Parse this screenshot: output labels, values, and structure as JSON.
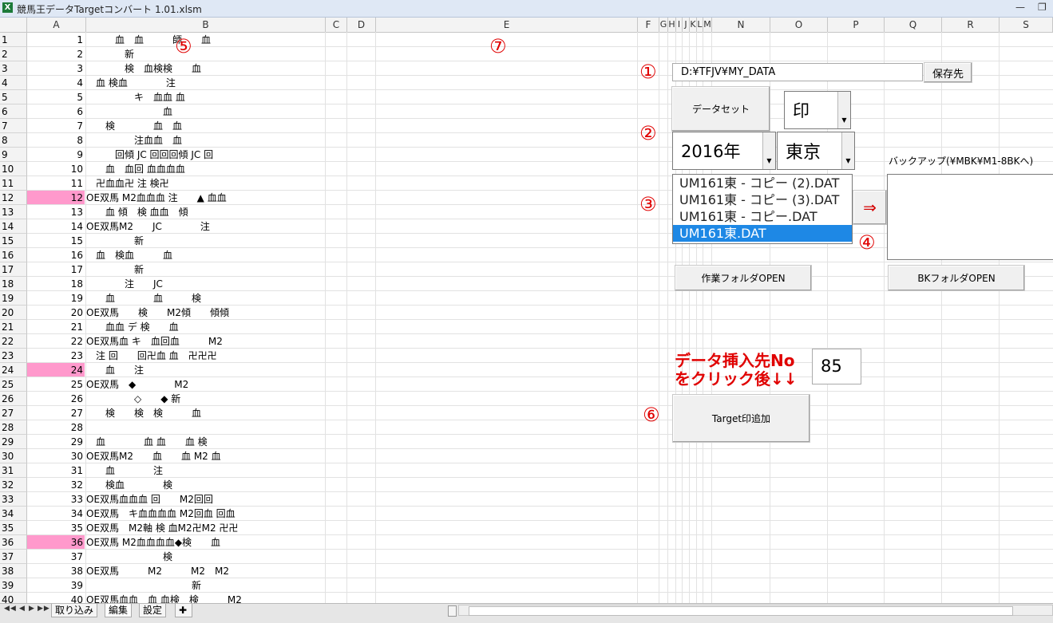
{
  "window": {
    "title": "競馬王データTargetコンバート 1.01.xlsm",
    "minimize_glyph": "—",
    "restore_glyph": "❐"
  },
  "columns": [
    "A",
    "B",
    "C",
    "D",
    "E",
    "F",
    "G",
    "H",
    "I",
    "J",
    "K",
    "L",
    "M",
    "N",
    "O",
    "P",
    "Q",
    "R",
    "S"
  ],
  "rows": [
    {
      "n": "1",
      "a": "1",
      "b": "　　　血　血　　　師　　血",
      "hl": false
    },
    {
      "n": "2",
      "a": "2",
      "b": "　　　　新",
      "hl": false
    },
    {
      "n": "3",
      "a": "3",
      "b": "　　　　検　血検検　　血",
      "hl": false
    },
    {
      "n": "4",
      "a": "4",
      "b": "　血 検血　　　　注",
      "hl": false
    },
    {
      "n": "5",
      "a": "5",
      "b": "　　　　　キ　血血 血",
      "hl": false
    },
    {
      "n": "6",
      "a": "6",
      "b": "　　　　　　　　血",
      "hl": false
    },
    {
      "n": "7",
      "a": "7",
      "b": "　　検　　　　血　血",
      "hl": false
    },
    {
      "n": "8",
      "a": "8",
      "b": "　　　　　注血血　血",
      "hl": false
    },
    {
      "n": "9",
      "a": "9",
      "b": "　　　回傾 JC 回回回傾 JC 回",
      "hl": false
    },
    {
      "n": "10",
      "a": "10",
      "b": "　　血　血回 血血血血",
      "hl": false
    },
    {
      "n": "11",
      "a": "11",
      "b": "　卍血血卍 注 検卍",
      "hl": false
    },
    {
      "n": "12",
      "a": "12",
      "b": "OE双馬 M2血血血 注　　▲ 血血",
      "hl": true
    },
    {
      "n": "13",
      "a": "13",
      "b": "　　血 傾　検 血血　傾",
      "hl": false
    },
    {
      "n": "14",
      "a": "14",
      "b": "OE双馬M2　　JC　　　　注",
      "hl": false
    },
    {
      "n": "15",
      "a": "15",
      "b": "　　　　　新",
      "hl": false
    },
    {
      "n": "16",
      "a": "16",
      "b": "　血　検血　　　血",
      "hl": false
    },
    {
      "n": "17",
      "a": "17",
      "b": "　　　　　新",
      "hl": false
    },
    {
      "n": "18",
      "a": "18",
      "b": "　　　　注　　JC",
      "hl": false
    },
    {
      "n": "19",
      "a": "19",
      "b": "　　血　　　　血　　　検",
      "hl": false
    },
    {
      "n": "20",
      "a": "20",
      "b": "OE双馬　　検　　M2傾　　傾傾",
      "hl": false
    },
    {
      "n": "21",
      "a": "21",
      "b": "　　血血 デ 検　　血",
      "hl": false
    },
    {
      "n": "22",
      "a": "22",
      "b": "OE双馬血 キ　血回血　　　M2",
      "hl": false
    },
    {
      "n": "23",
      "a": "23",
      "b": "　注 回　　回卍血 血　卍卍卍",
      "hl": false
    },
    {
      "n": "24",
      "a": "24",
      "b": "　　血　　注",
      "hl": true
    },
    {
      "n": "25",
      "a": "25",
      "b": "OE双馬　◆　　　　M2",
      "hl": false
    },
    {
      "n": "26",
      "a": "26",
      "b": "　　　　　◇　　◆ 新",
      "hl": false
    },
    {
      "n": "27",
      "a": "27",
      "b": "　　検　　検　検　　　血",
      "hl": false
    },
    {
      "n": "28",
      "a": "28",
      "b": "",
      "hl": false
    },
    {
      "n": "29",
      "a": "29",
      "b": "　血　　　　血 血　　血 検",
      "hl": false
    },
    {
      "n": "30",
      "a": "30",
      "b": "OE双馬M2　　血　　血 M2 血",
      "hl": false
    },
    {
      "n": "31",
      "a": "31",
      "b": "　　血　　　　注",
      "hl": false
    },
    {
      "n": "32",
      "a": "32",
      "b": "　　検血　　　　検",
      "hl": false
    },
    {
      "n": "33",
      "a": "33",
      "b": "OE双馬血血血 回　　M2回回",
      "hl": false
    },
    {
      "n": "34",
      "a": "34",
      "b": "OE双馬　キ血血血血 M2回血 回血",
      "hl": false
    },
    {
      "n": "35",
      "a": "35",
      "b": "OE双馬　M2軸 検 血M2卍M2 卍卍",
      "hl": false
    },
    {
      "n": "36",
      "a": "36",
      "b": "OE双馬 M2血血血血◆検　　血",
      "hl": true
    },
    {
      "n": "37",
      "a": "37",
      "b": "　　　　　　　　検",
      "hl": false
    },
    {
      "n": "38",
      "a": "38",
      "b": "OE双馬　　　M2　　　M2　M2",
      "hl": false
    },
    {
      "n": "39",
      "a": "39",
      "b": "　　　　　　　　　　　新",
      "hl": false
    },
    {
      "n": "40",
      "a": "40",
      "b": "OE双馬血血　血 血検　検　　　M2",
      "hl": false
    }
  ],
  "markers": {
    "m1": "①",
    "m2": "②",
    "m3": "③",
    "m4": "④",
    "m5": "⑤",
    "m6": "⑥",
    "m7": "⑦"
  },
  "controls": {
    "save_path_value": "D:¥TFJV¥MY_DATA",
    "save_button": "保存先",
    "dataset_button": "データセット",
    "mark_combo_value": "印",
    "year_combo_value": "2016年",
    "place_combo_value": "東京",
    "file_list": [
      {
        "label": "UM161東 - コピー (2).DAT",
        "selected": false
      },
      {
        "label": "UM161東 - コピー (3).DAT",
        "selected": false
      },
      {
        "label": "UM161東 - コピー.DAT",
        "selected": false
      },
      {
        "label": "UM161東.DAT",
        "selected": true
      }
    ],
    "move_button": "⇒",
    "backup_label": "バックアップ(¥MBK¥M1-8BKへ)",
    "work_folder_button": "作業フォルダOPEN",
    "bk_folder_button": "BKフォルダOPEN",
    "insert_hint_line1": "データ挿入先No",
    "insert_hint_line2": "をクリック後↓↓",
    "insert_no_value": "85",
    "target_add_button": "Target印追加"
  },
  "sheet_tabs": [
    {
      "label": "取り込み",
      "active": false
    },
    {
      "label": "編集",
      "active": true
    },
    {
      "label": "設定",
      "active": false
    }
  ],
  "nav_glyphs": [
    "◀◀",
    "◀",
    "▶",
    "▶▶"
  ]
}
